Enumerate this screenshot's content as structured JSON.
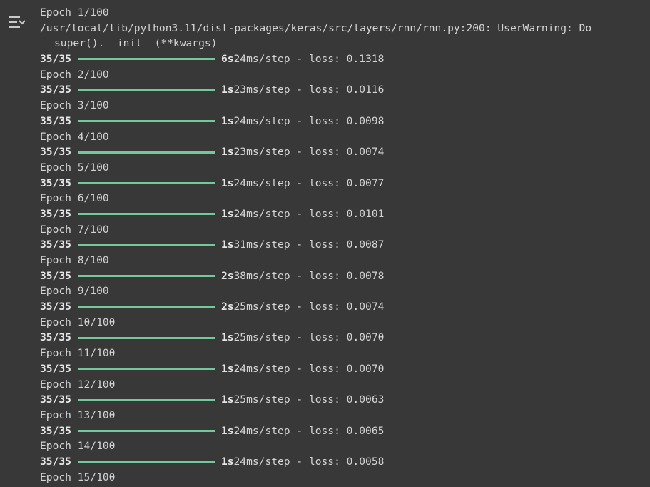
{
  "output": {
    "warning": {
      "path": "/usr/local/lib/python3.11/dist-packages/keras/src/layers/rnn/rnn.py:200: UserWarning: Do",
      "continuation": "super().__init__(**kwargs)"
    },
    "epochs": [
      {
        "label": "Epoch 1/100",
        "steps": "35/35",
        "time": "6s",
        "per_step": "24ms/step",
        "loss": "loss: 0.1318",
        "progress": 1.0
      },
      {
        "label": "Epoch 2/100",
        "steps": "35/35",
        "time": "1s",
        "per_step": "23ms/step",
        "loss": "loss: 0.0116",
        "progress": 1.0
      },
      {
        "label": "Epoch 3/100",
        "steps": "35/35",
        "time": "1s",
        "per_step": "24ms/step",
        "loss": "loss: 0.0098",
        "progress": 1.0
      },
      {
        "label": "Epoch 4/100",
        "steps": "35/35",
        "time": "1s",
        "per_step": "23ms/step",
        "loss": "loss: 0.0074",
        "progress": 1.0
      },
      {
        "label": "Epoch 5/100",
        "steps": "35/35",
        "time": "1s",
        "per_step": "24ms/step",
        "loss": "loss: 0.0077",
        "progress": 1.0
      },
      {
        "label": "Epoch 6/100",
        "steps": "35/35",
        "time": "1s",
        "per_step": "24ms/step",
        "loss": "loss: 0.0101",
        "progress": 1.0
      },
      {
        "label": "Epoch 7/100",
        "steps": "35/35",
        "time": "1s",
        "per_step": "31ms/step",
        "loss": "loss: 0.0087",
        "progress": 1.0
      },
      {
        "label": "Epoch 8/100",
        "steps": "35/35",
        "time": "2s",
        "per_step": "38ms/step",
        "loss": "loss: 0.0078",
        "progress": 1.0
      },
      {
        "label": "Epoch 9/100",
        "steps": "35/35",
        "time": "2s",
        "per_step": "25ms/step",
        "loss": "loss: 0.0074",
        "progress": 1.0
      },
      {
        "label": "Epoch 10/100",
        "steps": "35/35",
        "time": "1s",
        "per_step": "25ms/step",
        "loss": "loss: 0.0070",
        "progress": 1.0
      },
      {
        "label": "Epoch 11/100",
        "steps": "35/35",
        "time": "1s",
        "per_step": "24ms/step",
        "loss": "loss: 0.0070",
        "progress": 1.0
      },
      {
        "label": "Epoch 12/100",
        "steps": "35/35",
        "time": "1s",
        "per_step": "25ms/step",
        "loss": "loss: 0.0063",
        "progress": 1.0
      },
      {
        "label": "Epoch 13/100",
        "steps": "35/35",
        "time": "1s",
        "per_step": "24ms/step",
        "loss": "loss: 0.0065",
        "progress": 1.0
      },
      {
        "label": "Epoch 14/100",
        "steps": "35/35",
        "time": "1s",
        "per_step": "24ms/step",
        "loss": "loss: 0.0058",
        "progress": 1.0
      },
      {
        "label": "Epoch 15/100"
      }
    ]
  },
  "icons": {
    "toggle": "output-toggle-icon"
  },
  "colors": {
    "background": "#383838",
    "text": "#d4d4d4",
    "progress_bar": "#73c99a"
  }
}
